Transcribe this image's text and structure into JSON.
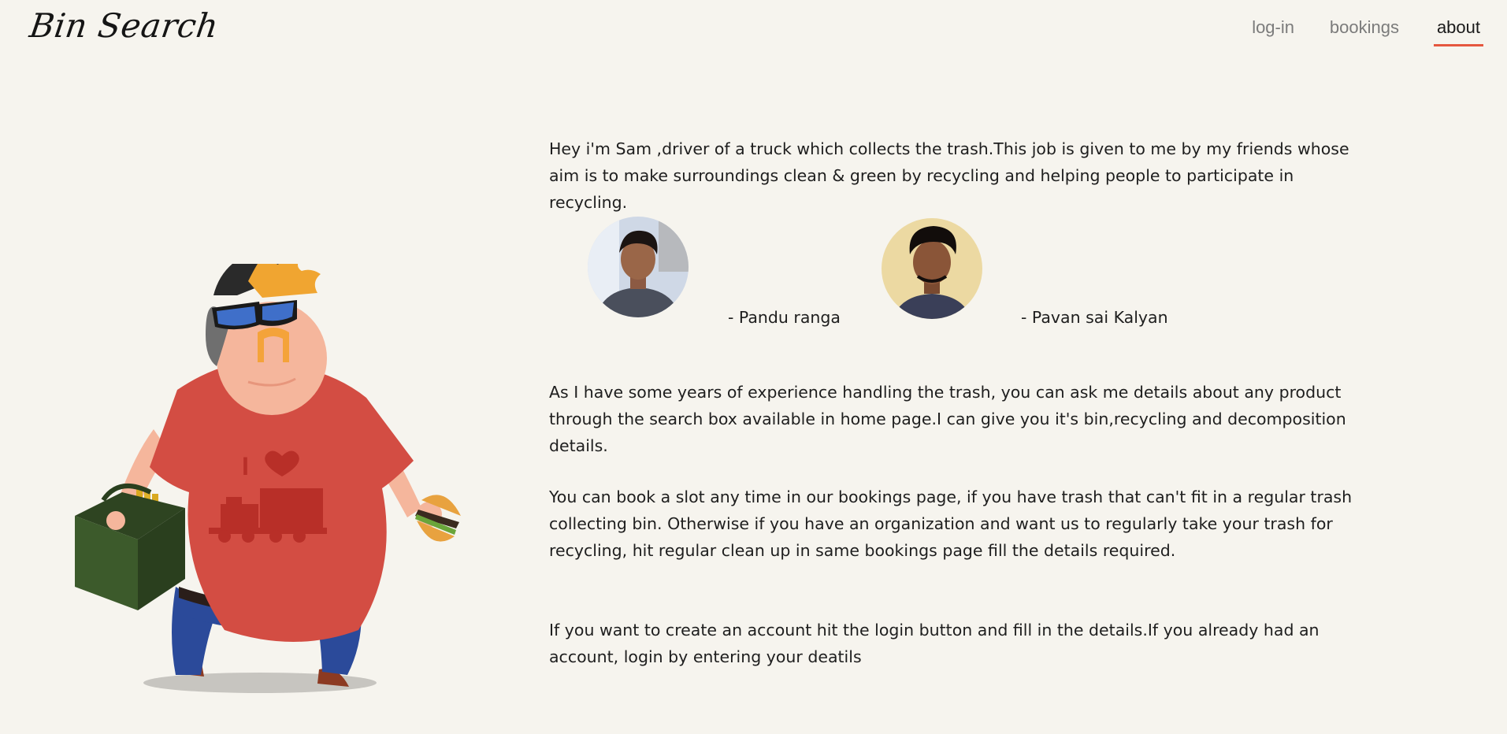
{
  "header": {
    "logo": "Bin Search",
    "nav": [
      {
        "label": "log-in",
        "active": false
      },
      {
        "label": "bookings",
        "active": false
      },
      {
        "label": "about",
        "active": true
      }
    ]
  },
  "about": {
    "intro": "Hey i'm Sam ,driver of a truck which collects the trash.This job is given to me by my friends whose aim is to make surroundings clean & green by recycling and helping people to participate in recycling.",
    "team": [
      {
        "name": "- Pandu ranga"
      },
      {
        "name": "- Pavan sai Kalyan"
      }
    ],
    "para_search": "As I have some years of experience handling the trash, you can ask me details about any product through the search box available in home page.I can give you it's bin,recycling and decomposition details.",
    "para_bookings": "You can book a slot any time in our bookings page, if you have trash that can't fit in a regular trash collecting bin. Otherwise if you have an organization and want us to regularly take your trash for recycling, hit regular clean up in same bookings page fill the details required.",
    "para_account": "If you want to create an account hit the login button and fill in the details.If you already had an account, login by entering your deatils",
    "illustration_text": "I"
  },
  "colors": {
    "background": "#f6f4ee",
    "accent": "#e5573f",
    "shirt": "#d34d43",
    "truck": "#b82f28"
  }
}
